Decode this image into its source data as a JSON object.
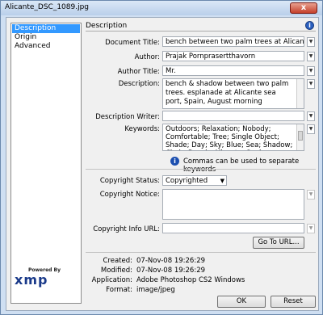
{
  "window": {
    "title": "Alicante_DSC_1089.jpg",
    "close_label": "x"
  },
  "nav": {
    "items": [
      "Description",
      "Origin",
      "Advanced"
    ],
    "selected": "Description"
  },
  "brand": {
    "powered_by": "Powered By",
    "logo": "xmp"
  },
  "section": {
    "title": "Description",
    "info_icon": "i"
  },
  "fields": {
    "document_title": {
      "label": "Document Title:",
      "value": "bench between two palm trees at Alicante, Spain. A"
    },
    "author": {
      "label": "Author:",
      "value": "Prajak Pornprasertthavorn"
    },
    "author_title": {
      "label": "Author Title:",
      "value": "Mr."
    },
    "description": {
      "label": "Description:",
      "value": "bench & shadow between two palm trees. esplanade at Alicante sea port, Spain, August morning"
    },
    "description_writer": {
      "label": "Description Writer:",
      "value": ""
    },
    "keywords": {
      "label": "Keywords:",
      "value": "Outdoors; Relaxation; Nobody; Comfortable; Tree; Single Object; Shade; Day; Sky; Blue; Sea; Shadow; Chair; Bench; Alicante; Spain; Harbor;"
    },
    "keywords_hint": {
      "icon": "i",
      "text": "Commas can be used to separate keywords"
    },
    "copyright_status": {
      "label": "Copyright Status:",
      "value": "Copyrighted"
    },
    "copyright_notice": {
      "label": "Copyright Notice:",
      "value": ""
    },
    "copyright_url": {
      "label": "Copyright Info URL:",
      "value": ""
    }
  },
  "buttons": {
    "go_to_url": "Go To URL...",
    "ok": "OK",
    "reset": "Reset"
  },
  "metadata": {
    "created": {
      "label": "Created:",
      "value": "07-Nov-08 19:26:29"
    },
    "modified": {
      "label": "Modified:",
      "value": "07-Nov-08 19:26:29"
    },
    "application": {
      "label": "Application:",
      "value": "Adobe Photoshop CS2 Windows"
    },
    "format": {
      "label": "Format:",
      "value": "image/jpeg"
    }
  }
}
